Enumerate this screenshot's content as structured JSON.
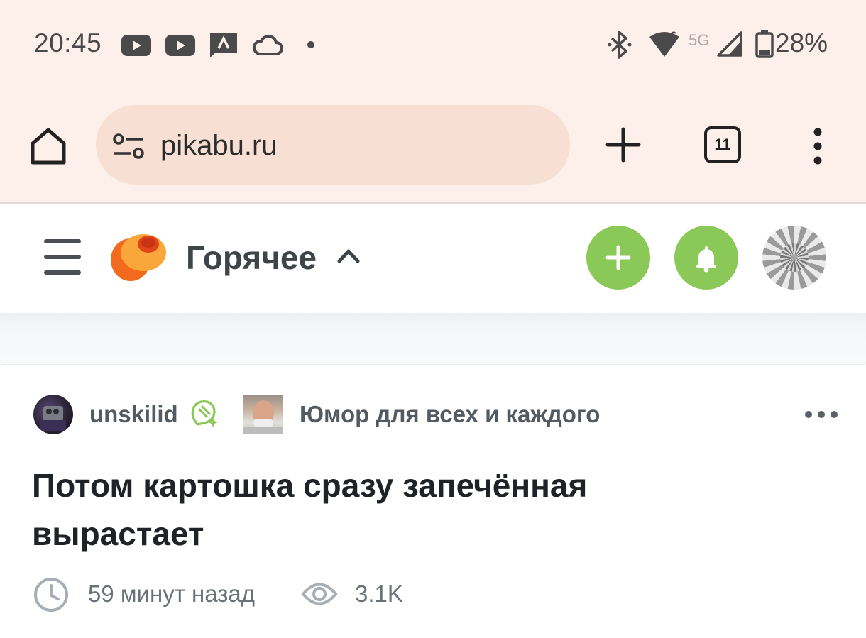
{
  "status_bar": {
    "time": "20:45",
    "battery": "28%",
    "network": "5G",
    "wifi_badge": "6",
    "icons": [
      "youtube-icon",
      "youtube-icon",
      "app-notification-icon",
      "cloud-icon",
      "dot-icon",
      "bluetooth-icon",
      "wifi-icon",
      "signal-icon",
      "battery-icon"
    ]
  },
  "browser": {
    "url": "pikabu.ru",
    "tab_count": "11",
    "icons": [
      "home-icon",
      "site-settings-icon",
      "plus-icon",
      "tabs-icon",
      "more-vert-icon"
    ]
  },
  "site_header": {
    "section": "Горячее",
    "icons": [
      "menu-icon",
      "pikabu-logo",
      "chevron-up-icon",
      "plus-icon",
      "bell-icon",
      "avatar"
    ],
    "accent": "#8ac858"
  },
  "post": {
    "author": "unskilid",
    "community": "Юмор для всех и каждого",
    "title": "Потом картошка сразу запечённая вырастает",
    "time_ago": "59 минут назад",
    "views": "3.1K",
    "icons": [
      "author-badge-icon",
      "more-horiz-icon",
      "clock-icon",
      "eye-icon"
    ]
  }
}
